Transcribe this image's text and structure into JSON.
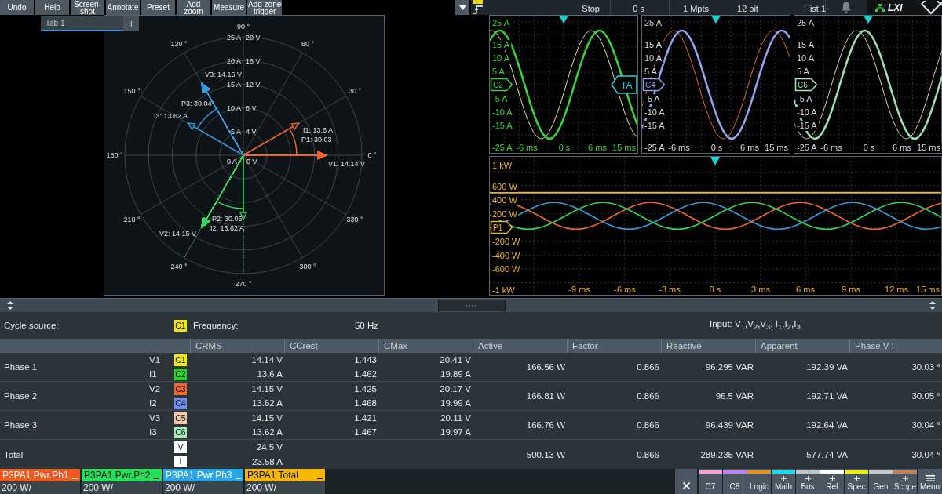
{
  "toolbar": {
    "buttons": [
      "Undo",
      "Help",
      "Screen-\nshot",
      "Annotate",
      "Preset",
      "Add\nzoom",
      "Measure",
      "Add zone\ntrigger"
    ]
  },
  "tabs": [
    {
      "label": "Tab 1",
      "selected": true
    }
  ],
  "phasor_diagram": {
    "angle_labels": [
      "0 °",
      "30 °",
      "60 °",
      "90 °",
      "120 °",
      "150 °",
      "180 °",
      "210 °",
      "240 °",
      "270 °",
      "300 °",
      "330 °"
    ],
    "current_scale": [
      "25 A",
      "20 A",
      "15 A",
      "10 A",
      "5 A",
      "0 A"
    ],
    "voltage_scale": [
      "20 V",
      "16 V",
      "12 V",
      "8 V",
      "4 V",
      "0 V"
    ],
    "phases": [
      {
        "voltage": "V3: 14.15 V",
        "current": "I3: 13.62 A",
        "phase": "P3: 30.04",
        "color": "#2f9de0",
        "guides": false
      },
      {
        "voltage": "V1: 14.14 V",
        "current": "I1: 13.6 A",
        "phase": "P1: 30.03",
        "color": "#f2642a",
        "guides": false
      },
      {
        "voltage": "V2: 14.15 V",
        "current": "I2: 13.62 A",
        "phase": "P2: 30.05",
        "color": "#2fd65a",
        "guides": true
      }
    ]
  },
  "scope": {
    "status": [
      "Stop",
      "0 s",
      "1 Mpts",
      "12 bit",
      "Hist 1"
    ],
    "logo": "LXI",
    "zoom_panels": [
      {
        "color": "#3fd43f",
        "marker": {
          "label": "C2",
          "color": "#3fd43f"
        },
        "trigger_marker": {
          "label": "TA",
          "color": "#22d3d8"
        },
        "y_labels": [
          "25 A",
          "15 A",
          "10 A",
          "5 A",
          "-5 A",
          "-10 A",
          "-15 A",
          "-25 A"
        ],
        "x_labels": [
          "-6 ms",
          "0 s",
          "6 ms",
          "15 ms"
        ]
      },
      {
        "color": "#d6dade",
        "marker": {
          "label": "C4",
          "color": "#8c9ef0"
        },
        "y_labels": [
          "25 A",
          "15 A",
          "10 A",
          "5 A",
          "-5 A",
          "-10 A",
          "-15 A",
          "-25 A"
        ],
        "x_labels": [
          "-6 ms",
          "0 s",
          "6 ms",
          "15 ms"
        ]
      },
      {
        "color": "#d6dade",
        "marker": {
          "label": "C6",
          "color": "#a4e6b6"
        },
        "y_labels": [
          "25 A",
          "15 A",
          "10 A",
          "5 A",
          "-5 A",
          "-10 A",
          "-15 A",
          "-25 A"
        ],
        "x_labels": [
          "-6 ms",
          "0 s",
          "6 ms",
          "15 ms"
        ]
      }
    ],
    "power_panel": {
      "color": "#f0b429",
      "marker": {
        "label": "P1",
        "color": "#f0b429"
      },
      "y_labels": [
        "1 kW",
        "600 W",
        "400 W",
        "200 W",
        "-200 W",
        "-400 W",
        "-600 W",
        "-1 kW"
      ],
      "x_labels": [
        "-9 ms",
        "-6 ms",
        "-3 ms",
        "0 s",
        "3 ms",
        "6 ms",
        "9 ms",
        "12 ms",
        "15 ms"
      ]
    }
  },
  "measurement": {
    "cycle_source_label": "Cycle source:",
    "cycle_source": {
      "label": "C1",
      "color": "#f0e614"
    },
    "frequency_label": "Frequency:",
    "frequency": "50 Hz",
    "input": "Input: V$_{1}$,V$_{2}$,V$_{3}$, I$_{1}$,I$_{2}$,I$_{3}$"
  },
  "table": {
    "columns": [
      "CRMS",
      "CCrest",
      "CMax",
      "Active",
      "Factor",
      "Reactive",
      "Apparent",
      "Phase V-I"
    ],
    "rows": [
      {
        "label": "Phase 1",
        "signals": [
          {
            "name": "V1",
            "channel": "C1",
            "color": "#f0e614",
            "crms": "14.14 V",
            "ccrest": "1.443",
            "cmax": "20.41 V"
          },
          {
            "name": "I1",
            "channel": "C2",
            "color": "#2bd42b",
            "crms": "13.6 A",
            "ccrest": "1.462",
            "cmax": "19.89 A"
          }
        ],
        "active": "166.56 W",
        "factor": "0.866",
        "reactive": "96.295 VAR",
        "apparent": "192.39 VA",
        "phase_vi": "30.03 °"
      },
      {
        "label": "Phase 2",
        "signals": [
          {
            "name": "V2",
            "channel": "C3",
            "color": "#f0682a",
            "crms": "14.15 V",
            "ccrest": "1.425",
            "cmax": "20.17 V"
          },
          {
            "name": "I2",
            "channel": "C4",
            "color": "#6c8cf0",
            "crms": "13.62 A",
            "ccrest": "1.468",
            "cmax": "19.99 A"
          }
        ],
        "active": "166.81 W",
        "factor": "0.866",
        "reactive": "96.5 VAR",
        "apparent": "192.71 VA",
        "phase_vi": "30.05 °"
      },
      {
        "label": "Phase 3",
        "signals": [
          {
            "name": "V3",
            "channel": "C5",
            "color": "#f4c8a4",
            "crms": "14.15 V",
            "ccrest": "1.421",
            "cmax": "20.11 V"
          },
          {
            "name": "I3",
            "channel": "C6",
            "color": "#a6eab8",
            "crms": "13.62 A",
            "ccrest": "1.467",
            "cmax": "19.97 A"
          }
        ],
        "active": "166.76 W",
        "factor": "0.866",
        "reactive": "96.439 VAR",
        "apparent": "192.64 VA",
        "phase_vi": "30.04 °"
      },
      {
        "label": "Total",
        "signals": [
          {
            "channel": "V",
            "color": "#ffffff",
            "crms": "24.5 V"
          },
          {
            "channel": "I",
            "color": "#ffffff",
            "crms": "23.58 A"
          }
        ],
        "active": "500.13 W",
        "factor": "0.866",
        "reactive": "289.235 VAR",
        "apparent": "577.74 VA",
        "phase_vi": "30.04 °"
      }
    ]
  },
  "signals": [
    {
      "title": "P3PA1 Pwr.Ph1",
      "scale": "200 W/",
      "color": "#f2581f"
    },
    {
      "title": "P3PA1 Pwr.Ph2",
      "scale": "200 W/",
      "color": "#22e05a"
    },
    {
      "title": "P3PA1 Pwr.Ph3",
      "scale": "200 W/",
      "color": "#2aa5e8"
    },
    {
      "title": "P3PA1 Total",
      "scale": "200 W/",
      "color": "#f5b800"
    }
  ],
  "toolbox": {
    "tools": [
      {
        "label": "C7",
        "color": "#f4a0d0",
        "addable": false
      },
      {
        "label": "C8",
        "color": "#c080f0",
        "addable": false
      },
      {
        "label": "Logic",
        "color": "#e0921a",
        "addable": false
      },
      {
        "label": "Math",
        "color": "#10e0f0",
        "addable": true
      },
      {
        "label": "Bus",
        "color": "#c4c4c4",
        "addable": true
      },
      {
        "label": "Ref",
        "color": "#ffffff",
        "addable": true
      },
      {
        "label": "Spec",
        "color": "#f0f000",
        "addable": true
      },
      {
        "label": "Gen",
        "color": "#c8c8c8",
        "addable": false
      },
      {
        "label": "Scope",
        "color": "#c0805a",
        "addable": true
      }
    ],
    "menu": "Menu"
  }
}
